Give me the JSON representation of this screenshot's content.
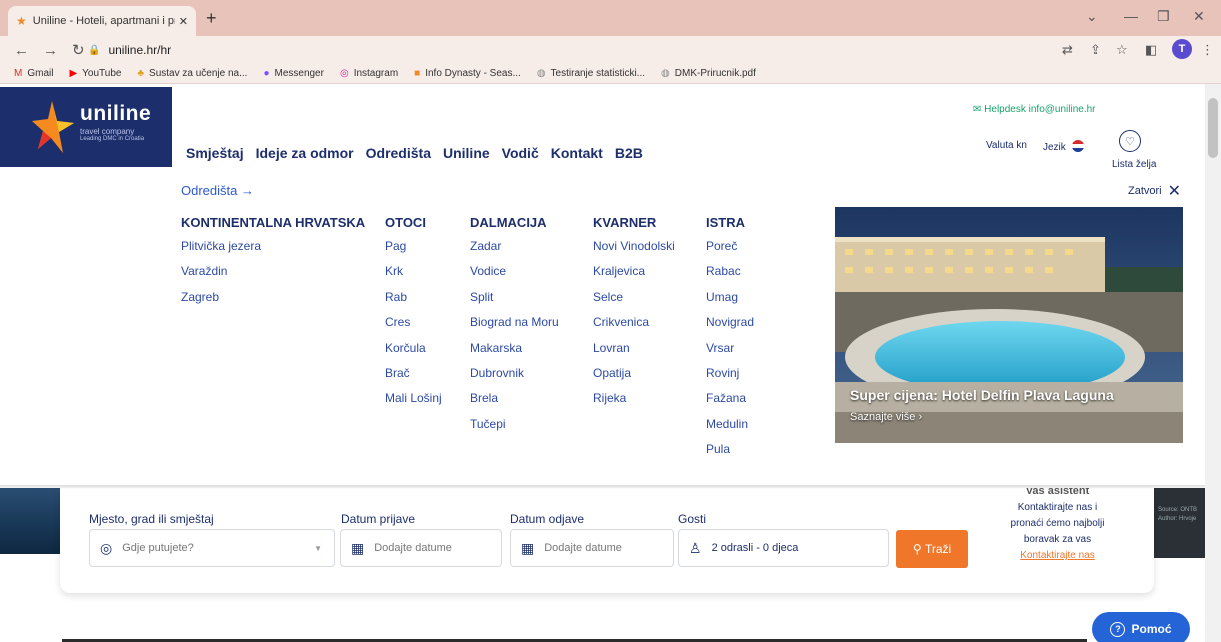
{
  "browser": {
    "tab_title": "Uniline - Hoteli, apartmani i priv",
    "new_tab": "+",
    "url": "uniline.hr/hr",
    "profile_initial": "T",
    "bookmarks": [
      {
        "label": "Gmail",
        "icon": "M",
        "color": "#d93025"
      },
      {
        "label": "YouTube",
        "icon": "▶",
        "color": "#ff0000"
      },
      {
        "label": "Sustav za učenje na...",
        "icon": "♣",
        "color": "#e0a020"
      },
      {
        "label": "Messenger",
        "icon": "●",
        "color": "#7b4dff"
      },
      {
        "label": "Instagram",
        "icon": "◎",
        "color": "#d6249f"
      },
      {
        "label": "Info Dynasty - Seas...",
        "icon": "■",
        "color": "#f08a24"
      },
      {
        "label": "Testiranje statisticki...",
        "icon": "◍",
        "color": "#888888"
      },
      {
        "label": "DMK-Prirucnik.pdf",
        "icon": "◍",
        "color": "#888888"
      }
    ]
  },
  "header": {
    "logo_name": "uniline",
    "logo_sub": "travel company",
    "logo_tagline": "Leading DMC in Croatia",
    "nav": [
      "Smještaj",
      "Ideje za odmor",
      "Odredišta",
      "Uniline",
      "Vodič",
      "Kontakt",
      "B2B"
    ],
    "helpdesk": "Helpdesk info@uniline.hr",
    "valuta": "Valuta kn",
    "jezik": "Jezik",
    "lista": "Lista želja"
  },
  "megamenu": {
    "title": "Odredišta",
    "close": "Zatvori",
    "columns": [
      {
        "heading": "KONTINENTALNA HRVATSKA",
        "items": [
          "Plitvička jezera",
          "Varaždin",
          "Zagreb"
        ]
      },
      {
        "heading": "OTOCI",
        "items": [
          "Pag",
          "Krk",
          "Rab",
          "Cres",
          "Korčula",
          "Brač",
          "Mali Lošinj"
        ]
      },
      {
        "heading": "DALMACIJA",
        "items": [
          "Zadar",
          "Vodice",
          "Split",
          "Biograd na Moru",
          "Makarska",
          "Dubrovnik",
          "Brela",
          "Tučepi"
        ]
      },
      {
        "heading": "KVARNER",
        "items": [
          "Novi Vinodolski",
          "Kraljevica",
          "Selce",
          "Crikvenica",
          "Lovran",
          "Opatija",
          "Rijeka"
        ]
      },
      {
        "heading": "ISTRA",
        "items": [
          "Poreč",
          "Rabac",
          "Umag",
          "Novigrad",
          "Vrsar",
          "Rovinj",
          "Fažana",
          "Medulin",
          "Pula"
        ]
      }
    ],
    "promo_title": "Super cijena: Hotel Delfin Plava Laguna",
    "promo_more": "Saznajte više"
  },
  "search": {
    "place_label": "Mjesto, grad ili smještaj",
    "place_placeholder": "Gdje putujete?",
    "checkin_label": "Datum prijave",
    "checkin_placeholder": "Dodajte datume",
    "checkout_label": "Datum odjave",
    "checkout_placeholder": "Dodajte datume",
    "guests_label": "Gosti",
    "guests_value": "2 odrasli - 0 djeca",
    "button": "Traži"
  },
  "assistant": {
    "heading": "Vaš asistent",
    "text1": "Kontaktirajte nas i",
    "text2": "pronaći ćemo najbolji",
    "text3": "boravak za vas",
    "link": "Kontaktirajte nas"
  },
  "hero_credit_1": "Source: ONTB",
  "hero_credit_2": "Author: Hrvoje",
  "help_button": "Pomoć"
}
